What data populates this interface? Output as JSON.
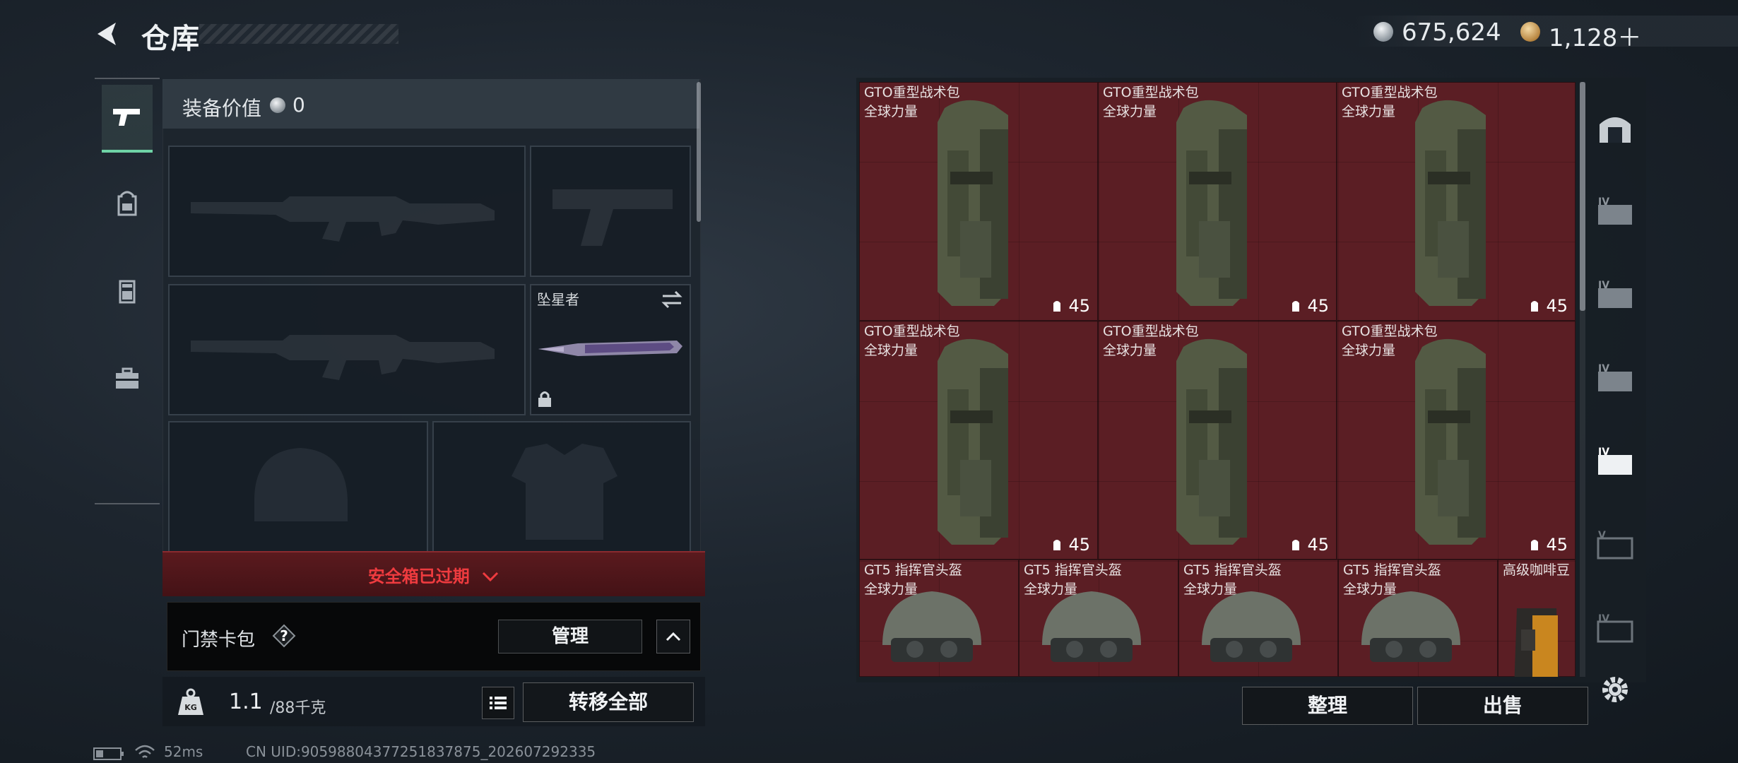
{
  "header": {
    "title": "仓库"
  },
  "currency": {
    "silver": "675,624",
    "gold": "1,128＋"
  },
  "loadout": {
    "equip_value_label": "装备价值",
    "equip_value": "0",
    "melee_name": "坠星者",
    "expired_label": "安全箱已过期",
    "keycard_label": "门禁卡包",
    "manage_label": "管理",
    "weight_current": "1.1",
    "weight_capacity": "/88千克",
    "transfer_all_label": "转移全部"
  },
  "storage": {
    "items": [
      {
        "name": "GTO重型战术包",
        "brand": "全球力量",
        "count": "45"
      },
      {
        "name": "GTO重型战术包",
        "brand": "全球力量",
        "count": "45"
      },
      {
        "name": "GTO重型战术包",
        "brand": "全球力量",
        "count": "45"
      },
      {
        "name": "GTO重型战术包",
        "brand": "全球力量",
        "count": "45"
      },
      {
        "name": "GTO重型战术包",
        "brand": "全球力量",
        "count": "45"
      },
      {
        "name": "GTO重型战术包",
        "brand": "全球力量",
        "count": "45"
      },
      {
        "name": "GT5 指挥官头盔",
        "brand": "全球力量"
      },
      {
        "name": "GT5 指挥官头盔",
        "brand": "全球力量"
      },
      {
        "name": "GT5 指挥官头盔",
        "brand": "全球力量"
      },
      {
        "name": "GT5 指挥官头盔",
        "brand": "全球力量"
      },
      {
        "name": "高级咖啡豆"
      }
    ],
    "sort_label": "整理",
    "sell_label": "出售"
  },
  "status_bar": {
    "ping": "52ms",
    "uid": "CN UID:9059880437725183787​5_202607292335"
  },
  "icons": {
    "back": "back-arrow-icon",
    "pistol": "pistol-icon",
    "backpack": "backpack-icon",
    "vest": "vest-icon",
    "case": "toolbox-icon",
    "settings": "gear-icon",
    "weight": "kg-weight-icon"
  },
  "colors": {
    "accent": "#6fd3a6",
    "storage_bg": "#5b1e24",
    "expired": "#ef3b3f"
  }
}
